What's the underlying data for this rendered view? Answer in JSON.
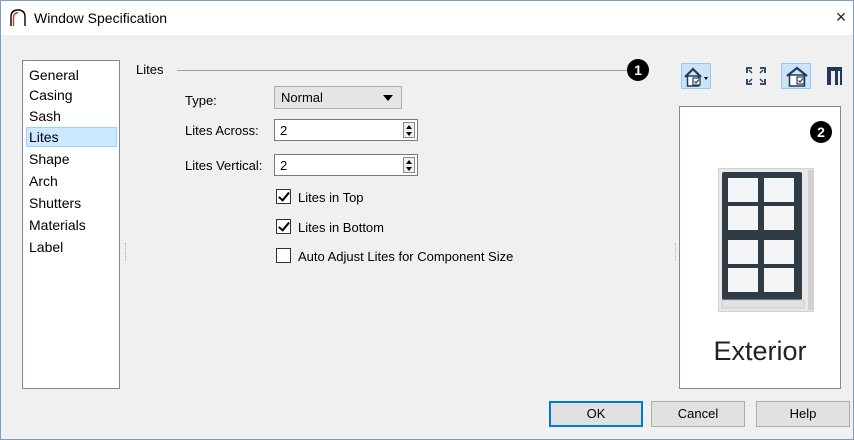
{
  "window": {
    "title": "Window Specification",
    "close_symbol": "×",
    "app_icon": "arch-window-icon"
  },
  "sidebar": {
    "items": [
      {
        "label": "General",
        "selected": false
      },
      {
        "label": "Casing",
        "selected": false
      },
      {
        "label": "Sash",
        "selected": false
      },
      {
        "label": "Lites",
        "selected": true
      },
      {
        "label": "Shape",
        "selected": false
      },
      {
        "label": "Arch",
        "selected": false
      },
      {
        "label": "Shutters",
        "selected": false
      },
      {
        "label": "Materials",
        "selected": false
      },
      {
        "label": "Label",
        "selected": false
      }
    ]
  },
  "lites": {
    "group_label": "Lites",
    "type_label": "Type:",
    "type_value": "Normal",
    "across_label": "Lites Across:",
    "across_value": "2",
    "vertical_label": "Lites Vertical:",
    "vertical_value": "2",
    "checkboxes": [
      {
        "label": "Lites in Top",
        "checked": true
      },
      {
        "label": "Lites in Bottom",
        "checked": true
      },
      {
        "label": "Auto Adjust Lites for Component Size",
        "checked": false
      }
    ]
  },
  "callouts": {
    "one": "1",
    "two": "2"
  },
  "toolbar": {
    "icons": [
      "view-type-dropdown-icon",
      "fill-window-icon",
      "color-toggle-icon",
      "side-view-icon"
    ]
  },
  "preview": {
    "label": "Exterior"
  },
  "buttons": {
    "ok": "OK",
    "cancel": "Cancel",
    "help": "Help"
  },
  "colors": {
    "selection": "#cce8ff",
    "accent": "#0078d7",
    "window_frame": "#2f3b45"
  }
}
